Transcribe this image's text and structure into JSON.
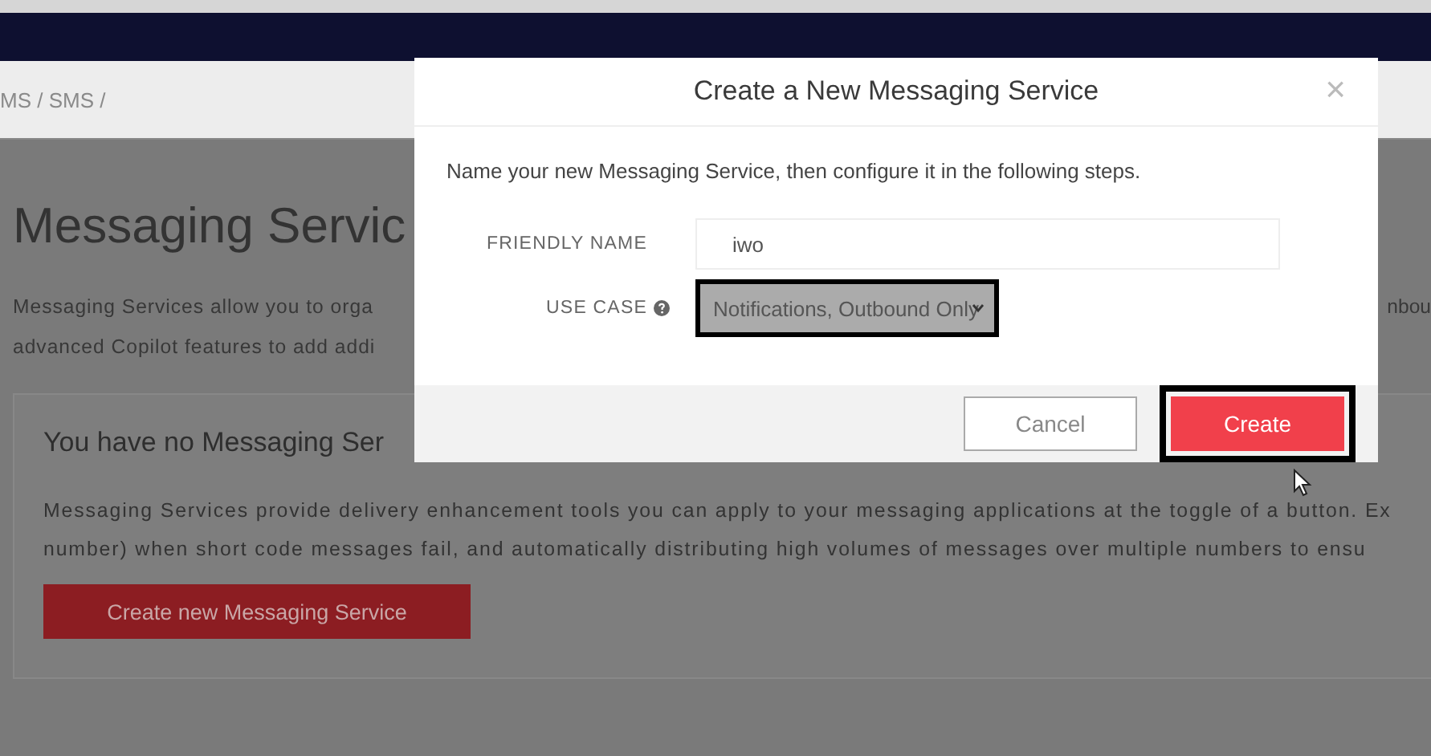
{
  "breadcrumb": "MS / SMS /",
  "page": {
    "heading": "Messaging Servic",
    "intro_lines": [
      "Messaging Services allow you to orga",
      "advanced Copilot features to add addi"
    ],
    "intro_fragment": "nbou"
  },
  "empty_card": {
    "title": "You have no Messaging Ser",
    "lines": [
      "Messaging Services provide delivery enhancement tools you can apply to your messaging applications at the toggle of a button. Ex",
      "number) when short code messages fail, and automatically distributing high volumes of messages over multiple numbers to ensu"
    ],
    "button": "Create new Messaging Service"
  },
  "modal": {
    "title": "Create a New Messaging Service",
    "close": "×",
    "description": "Name your new Messaging Service, then configure it in the following steps.",
    "fields": [
      {
        "kind": "text",
        "label": "FRIENDLY NAME",
        "value": "iwo",
        "help": false,
        "highlighted": false
      },
      {
        "kind": "select",
        "label": "USE CASE",
        "value": "Notifications, Outbound Only",
        "help": true,
        "highlighted": true
      }
    ],
    "buttons": [
      {
        "kind": "secondary",
        "label": "Cancel",
        "highlighted": false
      },
      {
        "kind": "primary",
        "label": "Create",
        "highlighted": true
      }
    ]
  }
}
